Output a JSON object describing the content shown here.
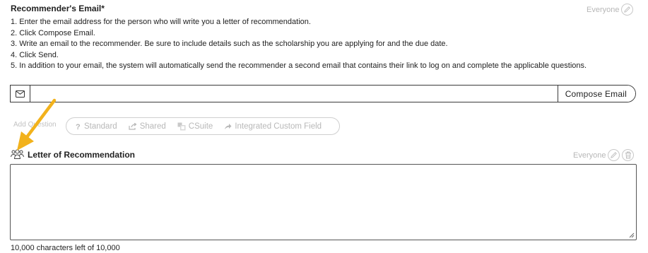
{
  "email_section": {
    "title": "Recommender's Email*",
    "visibility": "Everyone",
    "instructions": [
      "1. Enter the email address for the person who will write you a letter of recommendation.",
      "2. Click Compose Email.",
      "3. Write an email to the recommender. Be sure to include details such as the scholarship you are applying for and the due date.",
      "4. Click Send.",
      "5. In addition to your email, the system will automatically send the recommender a second email that contains their link to log on and complete the applicable questions."
    ],
    "email_value": "",
    "compose_label": "Compose Email"
  },
  "add_question": {
    "label": "Add Question",
    "types": [
      {
        "label": "Standard",
        "icon": "question-mark-icon"
      },
      {
        "label": "Shared",
        "icon": "share-icon"
      },
      {
        "label": "CSuite",
        "icon": "csuite-icon"
      },
      {
        "label": "Integrated Custom Field",
        "icon": "link-arrow-icon"
      }
    ]
  },
  "recommendation_section": {
    "title": "Letter of Recommendation",
    "visibility": "Everyone",
    "icon": "users-group-icon",
    "text_value": "",
    "char_count": "10,000 characters left of 10,000"
  },
  "colors": {
    "annotation_arrow": "#f2b21c",
    "muted_text": "#b8b8b8",
    "border": "#3a3a3a"
  }
}
